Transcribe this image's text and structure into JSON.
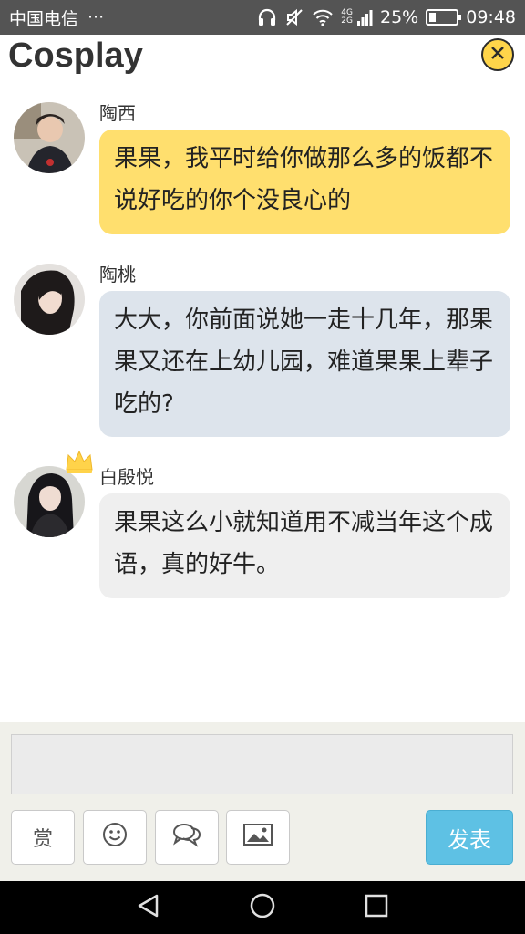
{
  "status_bar": {
    "carrier": "中国电信",
    "more": "···",
    "net_top": "4G",
    "net_bottom": "2G",
    "battery_percent": "25%",
    "battery_level": 0.25,
    "time": "09:48"
  },
  "header": {
    "title": "Cosplay",
    "close_icon": "close-circle-icon"
  },
  "messages": [
    {
      "sender": "陶西",
      "text": "果果，我平时给你做那么多的饭都不说好吃的你个没良心的",
      "bubble_color": "#ffdf6e"
    },
    {
      "sender": "陶桃",
      "text": "大大，你前面说她一走十几年，那果果又还在上幼儿园，难道果果上辈子吃的?",
      "bubble_color": "#dde4ec"
    },
    {
      "sender": "白殷悦",
      "text": "果果这么小就知道用不减当年这个成语，真的好牛。",
      "bubble_color": "#efefef"
    }
  ],
  "composer": {
    "input_value": "",
    "reward_label": "赏",
    "emoji_icon": "smiley-icon",
    "chat_icon": "speech-bubbles-icon",
    "image_icon": "image-icon",
    "send_label": "发表",
    "send_color": "#5ec1e4"
  },
  "nav_bar": {
    "back": "back-triangle-icon",
    "home": "home-circle-icon",
    "recents": "recents-square-icon"
  }
}
